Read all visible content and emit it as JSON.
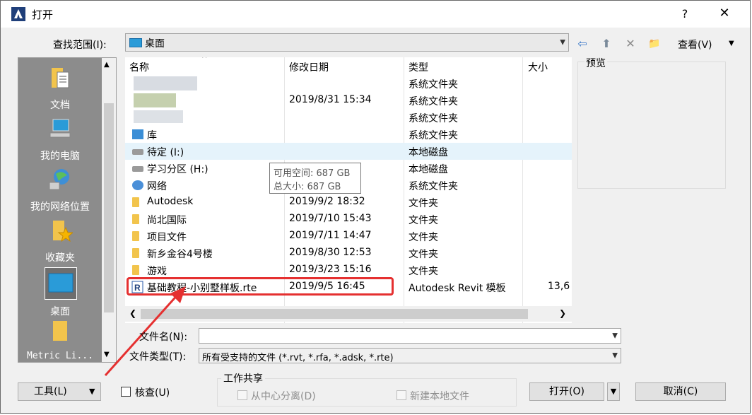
{
  "title": "打开",
  "title_buttons": {
    "help": "?",
    "close": "✕"
  },
  "look_in": {
    "label": "查找范围(I):",
    "value": "桌面"
  },
  "toolbar": {
    "back": "⇦",
    "up": "⬆",
    "delete": "✕",
    "new_folder": "📁",
    "views": "查看(V)"
  },
  "places": [
    {
      "label": "文档",
      "icon": "documents-folder-icon"
    },
    {
      "label": "我的电脑",
      "icon": "computer-icon"
    },
    {
      "label": "我的网络位置",
      "icon": "network-globe-icon"
    },
    {
      "label": "收藏夹",
      "icon": "favorites-star-icon"
    },
    {
      "label": "桌面",
      "icon": "desktop-monitor-icon"
    },
    {
      "label": "Metric Li...",
      "icon": "folder-icon"
    }
  ],
  "columns": {
    "name": "名称",
    "modified": "修改日期",
    "type": "类型",
    "size": "大小"
  },
  "files": [
    {
      "name": "",
      "modified": "",
      "type": "系统文件夹",
      "size": "",
      "icon": "blurred"
    },
    {
      "name": "",
      "modified": "2019/8/31 15:34",
      "type": "系统文件夹",
      "size": "",
      "icon": "blurred"
    },
    {
      "name": "",
      "modified": "",
      "type": "系统文件夹",
      "size": "",
      "icon": "blurred"
    },
    {
      "name": "库",
      "modified": "",
      "type": "系统文件夹",
      "size": "",
      "icon": "library-icon"
    },
    {
      "name": "待定 (I:)",
      "modified": "",
      "type": "本地磁盘",
      "size": "",
      "icon": "drive-icon"
    },
    {
      "name": "学习分区 (H:)",
      "modified": "",
      "type": "本地磁盘",
      "size": "",
      "icon": "drive-icon"
    },
    {
      "name": "网络",
      "modified": "",
      "type": "系统文件夹",
      "size": "",
      "icon": "network-icon"
    },
    {
      "name": "Autodesk",
      "modified": "2019/9/2 18:32",
      "type": "文件夹",
      "size": "",
      "icon": "folder-icon"
    },
    {
      "name": "尚北国际",
      "modified": "2019/7/10 15:43",
      "type": "文件夹",
      "size": "",
      "icon": "folder-icon"
    },
    {
      "name": "项目文件",
      "modified": "2019/7/11 14:47",
      "type": "文件夹",
      "size": "",
      "icon": "folder-icon"
    },
    {
      "name": "新乡金谷4号楼",
      "modified": "2019/8/30 12:53",
      "type": "文件夹",
      "size": "",
      "icon": "folder-icon"
    },
    {
      "name": "游戏",
      "modified": "2019/3/23 15:16",
      "type": "文件夹",
      "size": "",
      "icon": "folder-icon"
    },
    {
      "name": "基础教程-小别墅样板.rte",
      "modified": "2019/9/5 16:45",
      "type": "Autodesk Revit 模板",
      "size": "13,6",
      "icon": "revit-template-icon"
    }
  ],
  "tooltip": {
    "line1": "可用空间: 687 GB",
    "line2": "总大小: 687 GB"
  },
  "preview_label": "预览",
  "filename": {
    "label": "文件名(N):",
    "value": ""
  },
  "filetype": {
    "label": "文件类型(T):",
    "value": "所有受支持的文件 (*.rvt, *.rfa, *.adsk, *.rte)"
  },
  "tools_button": "工具(L)",
  "audit_label": "核查(U)",
  "worksharing": {
    "label": "工作共享",
    "detach": "从中心分离(D)",
    "new_local": "新建本地文件"
  },
  "open_button": "打开(O)",
  "cancel_button": "取消(C)",
  "colors": {
    "highlight": "#e53030",
    "places_bg": "#8c8c8c",
    "hover_row": "#e5f3fb"
  }
}
